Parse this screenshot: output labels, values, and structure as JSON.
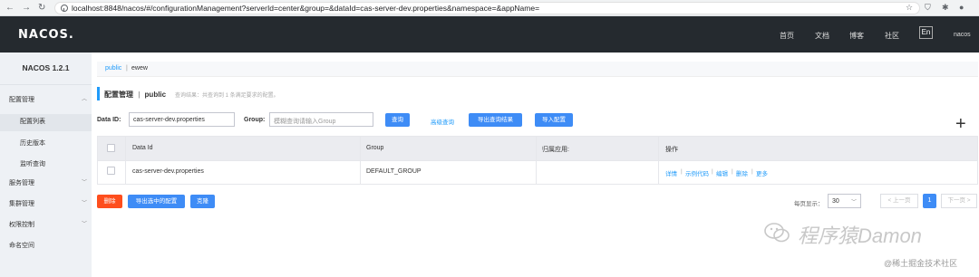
{
  "browser": {
    "url": "localhost:8848/nacos/#/configurationManagement?serverId=center&group=&dataId=cas-server-dev.properties&namespace=&appName="
  },
  "header": {
    "logo": "NACOS.",
    "nav": [
      "首页",
      "文档",
      "博客",
      "社区"
    ],
    "lang": "En",
    "user": "nacos"
  },
  "sidebar": {
    "version": "NACOS 1.2.1",
    "groups": [
      {
        "label": "配置管理",
        "items": [
          "配置列表",
          "历史版本",
          "监听查询"
        ]
      },
      {
        "label": "服务管理"
      },
      {
        "label": "集群管理"
      },
      {
        "label": "权限控制"
      },
      {
        "label": "命名空间"
      }
    ]
  },
  "namespaces": [
    "public",
    "ewew"
  ],
  "page": {
    "title": "配置管理",
    "sep": "|",
    "namespace": "public",
    "hint": "查询结果：共查询到 1 条满足要求的配置。"
  },
  "search": {
    "data_id_label": "Data ID:",
    "data_id_value": "cas-server-dev.properties",
    "group_label": "Group:",
    "group_placeholder": "模糊查询请输入Group",
    "query_btn": "查询",
    "advanced": "高级查询",
    "export_btn": "导出查询结果",
    "import_btn": "导入配置",
    "add": "+"
  },
  "table": {
    "headers": [
      "Data Id",
      "Group",
      "归属应用:",
      "操作"
    ],
    "rows": [
      {
        "data_id": "cas-server-dev.properties",
        "group": "DEFAULT_GROUP",
        "app": "",
        "ops": [
          "详情",
          "示例代码",
          "编辑",
          "删除",
          "更多"
        ]
      }
    ]
  },
  "bottom": {
    "delete_btn": "删除",
    "export_selected_btn": "导出选中的配置",
    "clone_btn": "克隆",
    "page_size_label": "每页显示：",
    "page_size": "30",
    "prev": "< 上一页",
    "current_page": "1",
    "next": "下一页 >"
  },
  "watermark": {
    "main": "程序猿Damon",
    "sub": "@稀土掘金技术社区"
  },
  "colors": {
    "primary": "#3e8cf6",
    "danger": "#fe4e1d",
    "header_bg": "#252a2f",
    "sidebar_bg": "#eef1f5"
  }
}
